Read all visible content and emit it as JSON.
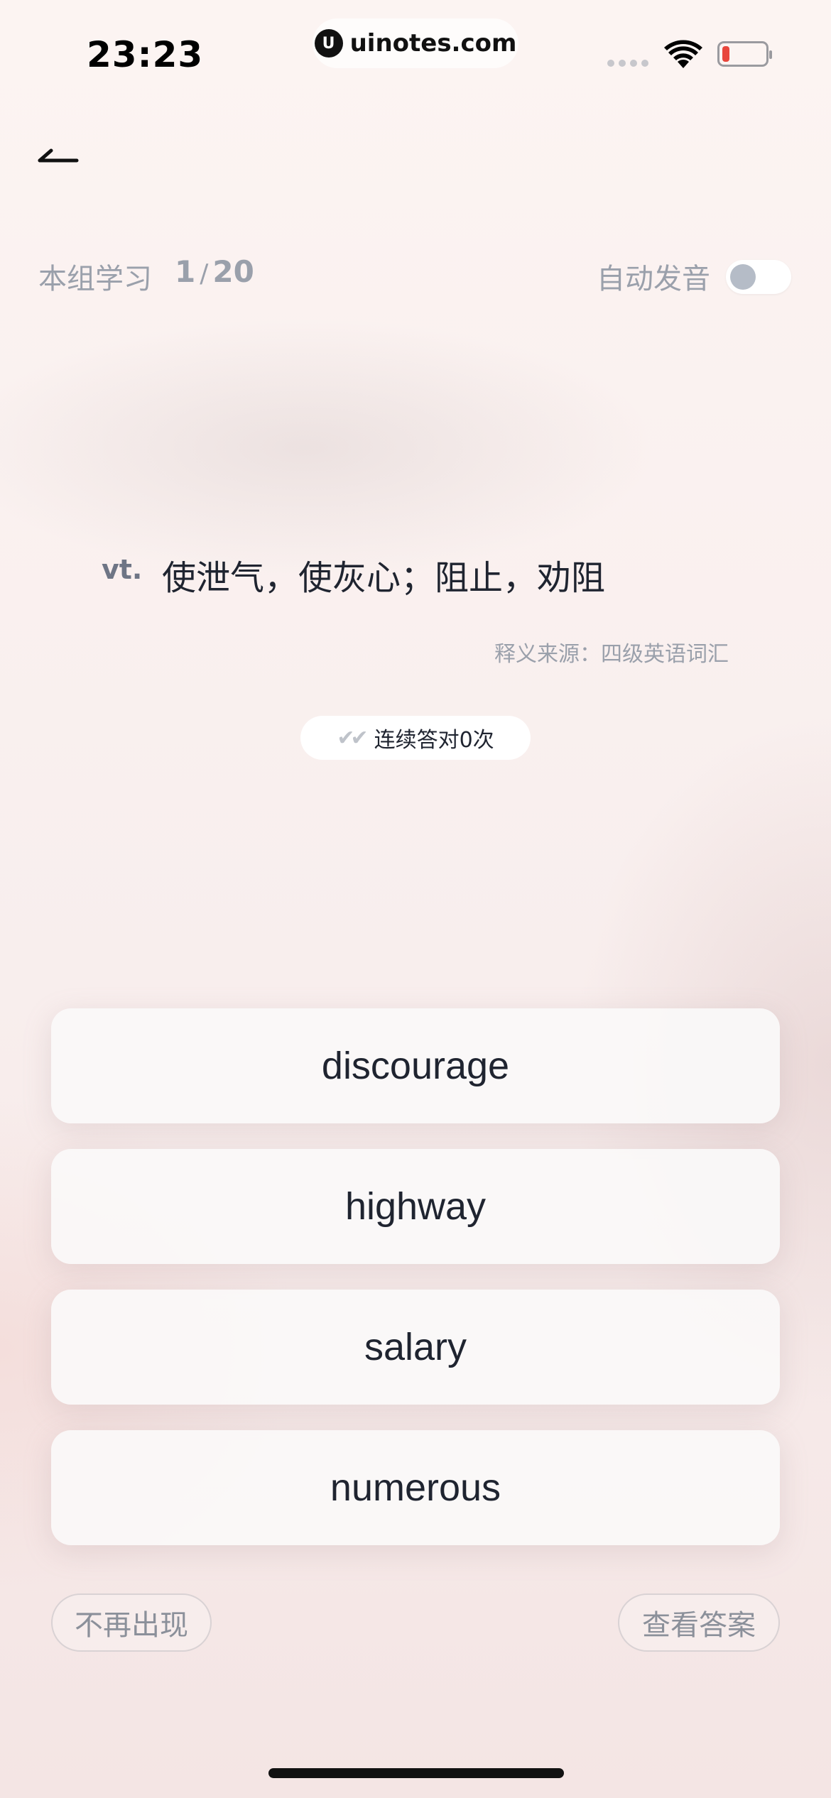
{
  "status_bar": {
    "time": "23:23",
    "url": "uinotes.com",
    "url_logo": "U"
  },
  "header": {
    "back_icon": "back-arrow-icon"
  },
  "progress": {
    "label": "本组学习",
    "current": "1",
    "separator": "/",
    "total": "20"
  },
  "auto_pronounce": {
    "label": "自动发音",
    "enabled": false
  },
  "definition": {
    "pos": "vt.",
    "meaning": "使泄气，使灰心；阻止，劝阻",
    "source": "释义来源：四级英语词汇"
  },
  "streak": {
    "icon": "✔✔",
    "text": "连续答对0次"
  },
  "options": [
    "discourage",
    "highway",
    "salary",
    "numerous"
  ],
  "actions": {
    "hide": "不再出现",
    "show_answer": "查看答案"
  }
}
